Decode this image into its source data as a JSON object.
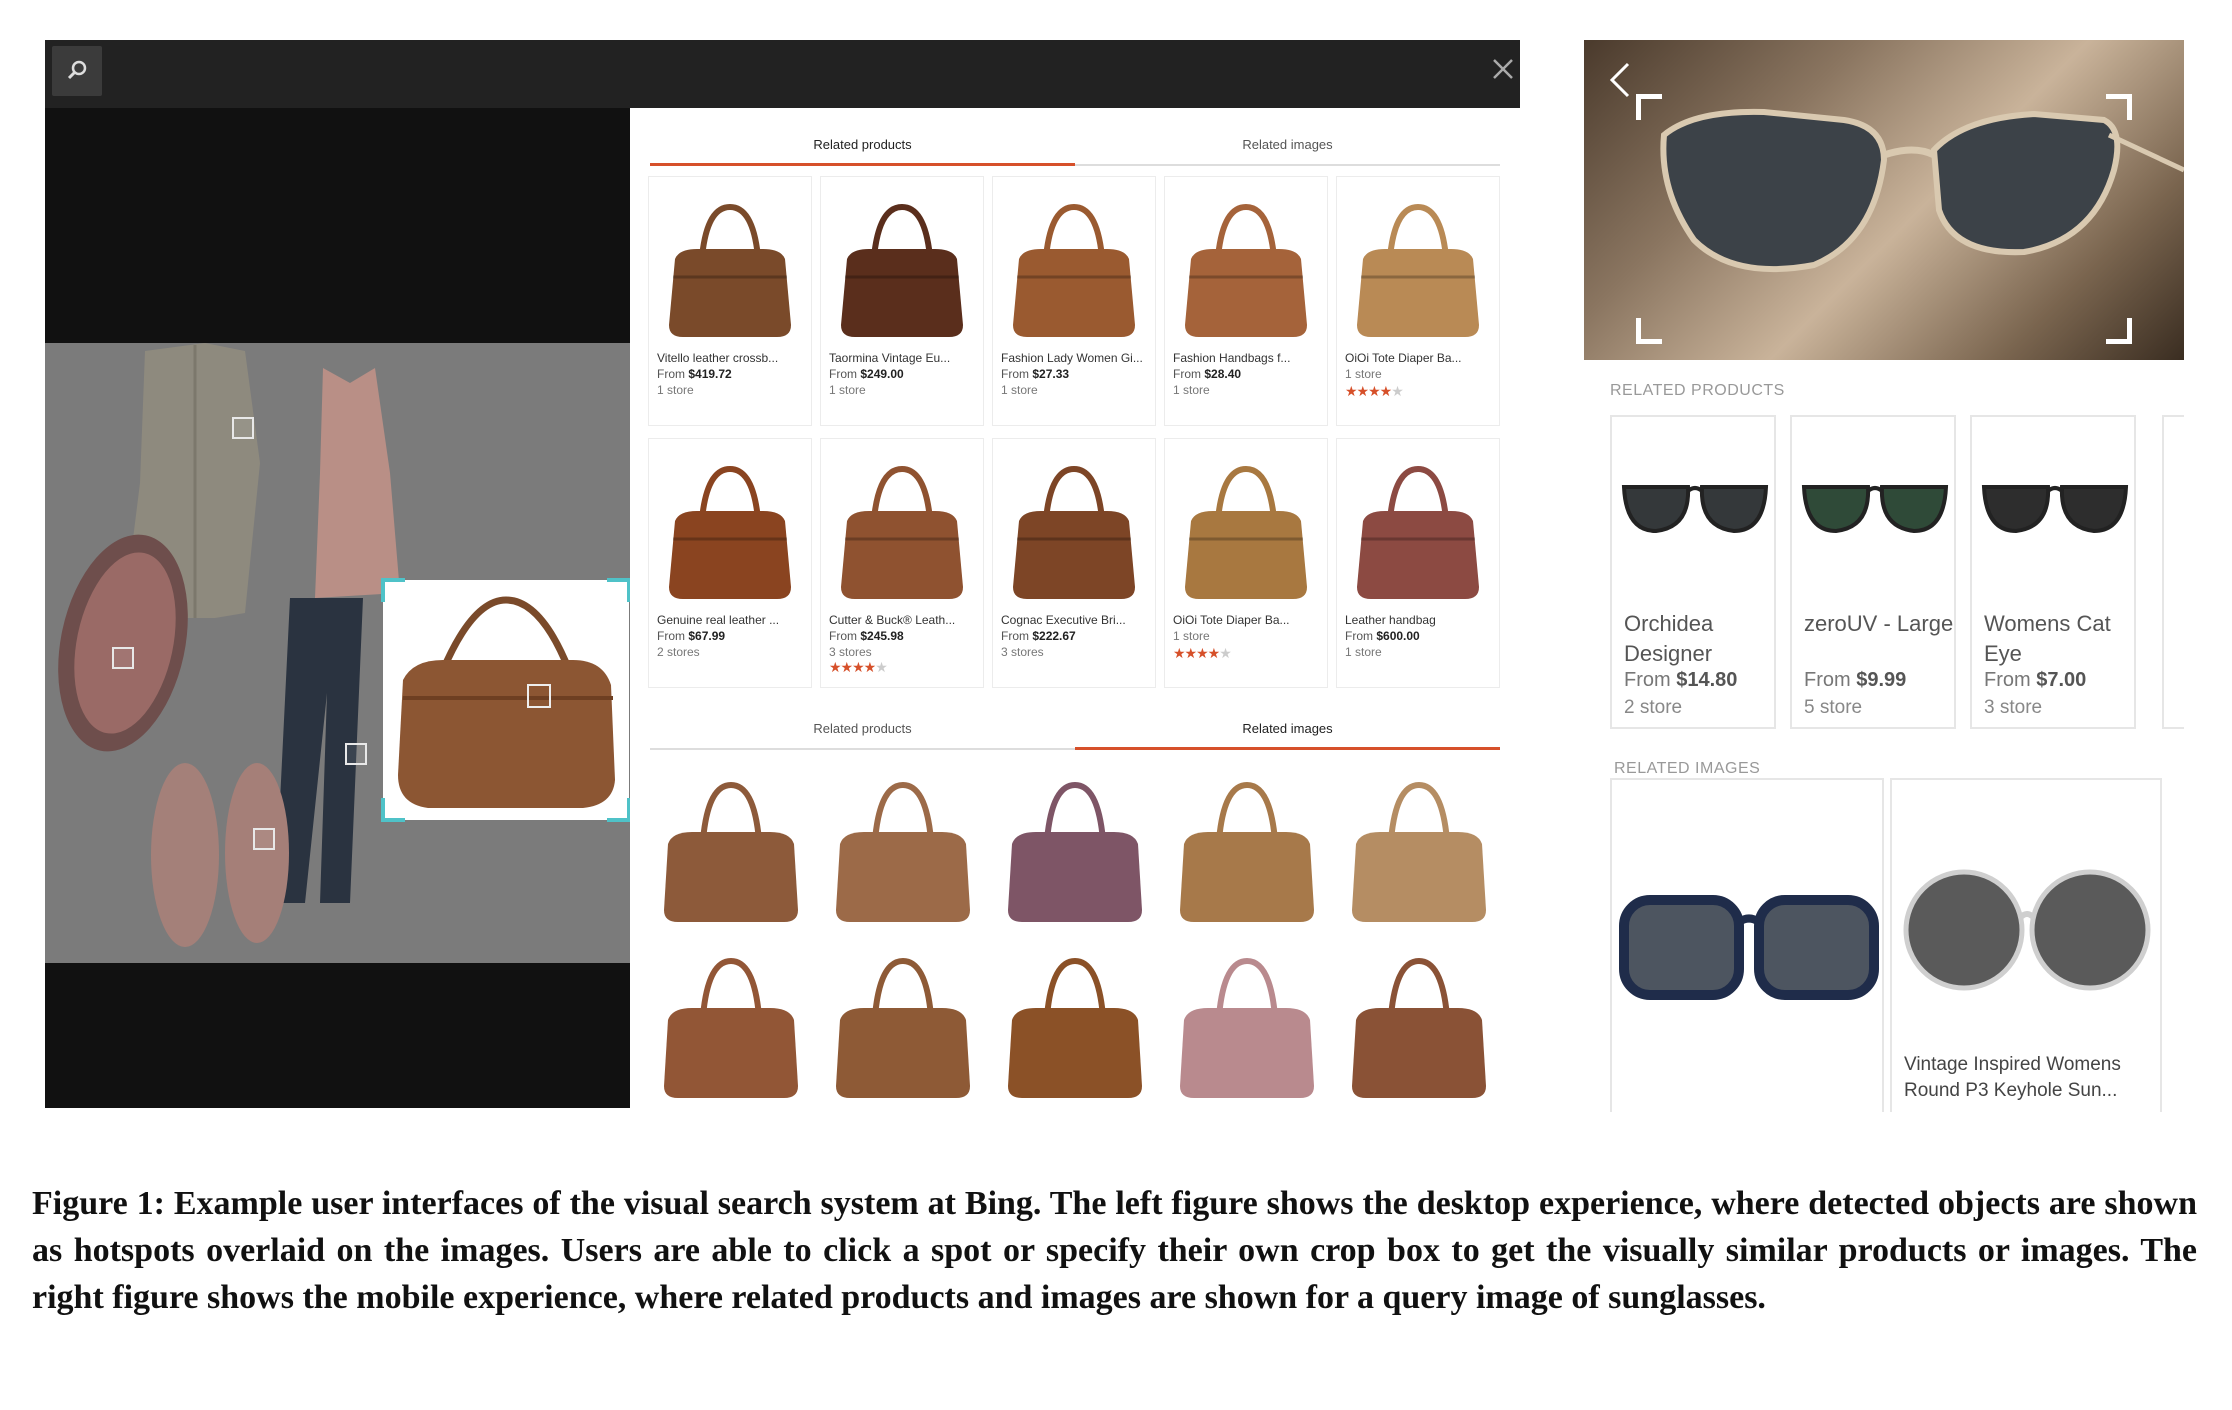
{
  "desktop": {
    "tabs_top": {
      "products": "Related products",
      "images": "Related images"
    },
    "tabs_bottom": {
      "products": "Related products",
      "images": "Related images"
    },
    "products_row1": [
      {
        "title": "Vitello leather crossb...",
        "price_prefix": "From",
        "price": "$419.72",
        "stores": "1 store",
        "color": "#7a4a2a"
      },
      {
        "title": "Taormina Vintage Eu...",
        "price_prefix": "From",
        "price": "$249.00",
        "stores": "1 store",
        "color": "#5a2e1c"
      },
      {
        "title": "Fashion Lady Women Gi...",
        "price_prefix": "From",
        "price": "$27.33",
        "stores": "1 store",
        "color": "#9a5a30"
      },
      {
        "title": "Fashion Handbags f...",
        "price_prefix": "From",
        "price": "$28.40",
        "stores": "1 store",
        "color": "#a5633a"
      },
      {
        "title": "OiOi Tote Diaper Ba...",
        "stores": "1 store",
        "rating": 3.5,
        "color": "#b98a55"
      }
    ],
    "products_row2": [
      {
        "title": "Genuine real leather ...",
        "price_prefix": "From",
        "price": "$67.99",
        "stores": "2 stores",
        "color": "#8a4420"
      },
      {
        "title": "Cutter & Buck® Leath...",
        "price_prefix": "From",
        "price": "$245.98",
        "stores": "3 stores",
        "rating": 3.5,
        "color": "#8f5230"
      },
      {
        "title": "Cognac Executive Bri...",
        "price_prefix": "From",
        "price": "$222.67",
        "stores": "3 stores",
        "color": "#7d4526"
      },
      {
        "title": "OiOi Tote Diaper Ba...",
        "stores": "1 store",
        "rating": 3.5,
        "color": "#a87840"
      },
      {
        "title": "Leather handbag",
        "price_prefix": "From",
        "price": "$600.00",
        "stores": "1 store",
        "color": "#8c4a42"
      }
    ],
    "related_images": [
      "#8d5a3a",
      "#9c6a48",
      "#7e5566",
      "#a7794a",
      "#b58d63",
      "#925636",
      "#8e5a36",
      "#8b5127",
      "#b98a8e",
      "#8a5236"
    ]
  },
  "mobile": {
    "related_products_label": "RELATED PRODUCTS",
    "related_images_label": "RELATED IMAGES",
    "products": [
      {
        "name": "Orchidea Designer",
        "price_prefix": "From",
        "price": "$14.80",
        "stores": "2 store"
      },
      {
        "name": "zeroUV - Large",
        "price_prefix": "From",
        "price": "$9.99",
        "stores": "5 store"
      },
      {
        "name": "Womens Cat Eye",
        "price_prefix": "From",
        "price": "$7.00",
        "stores": "3 store"
      }
    ],
    "images": [
      {
        "caption": ""
      },
      {
        "caption": "Vintage Inspired Womens Round P3 Keyhole Sun..."
      }
    ]
  },
  "caption": "Figure 1: Example user interfaces of the visual search system at Bing. The left figure shows the desktop experience, where detected objects are shown as hotspots overlaid on the images. Users are able to click a spot or specify their own crop box to get the visually similar products or images. The right figure shows the mobile experience, where related products and images are shown for a query image of sunglasses."
}
